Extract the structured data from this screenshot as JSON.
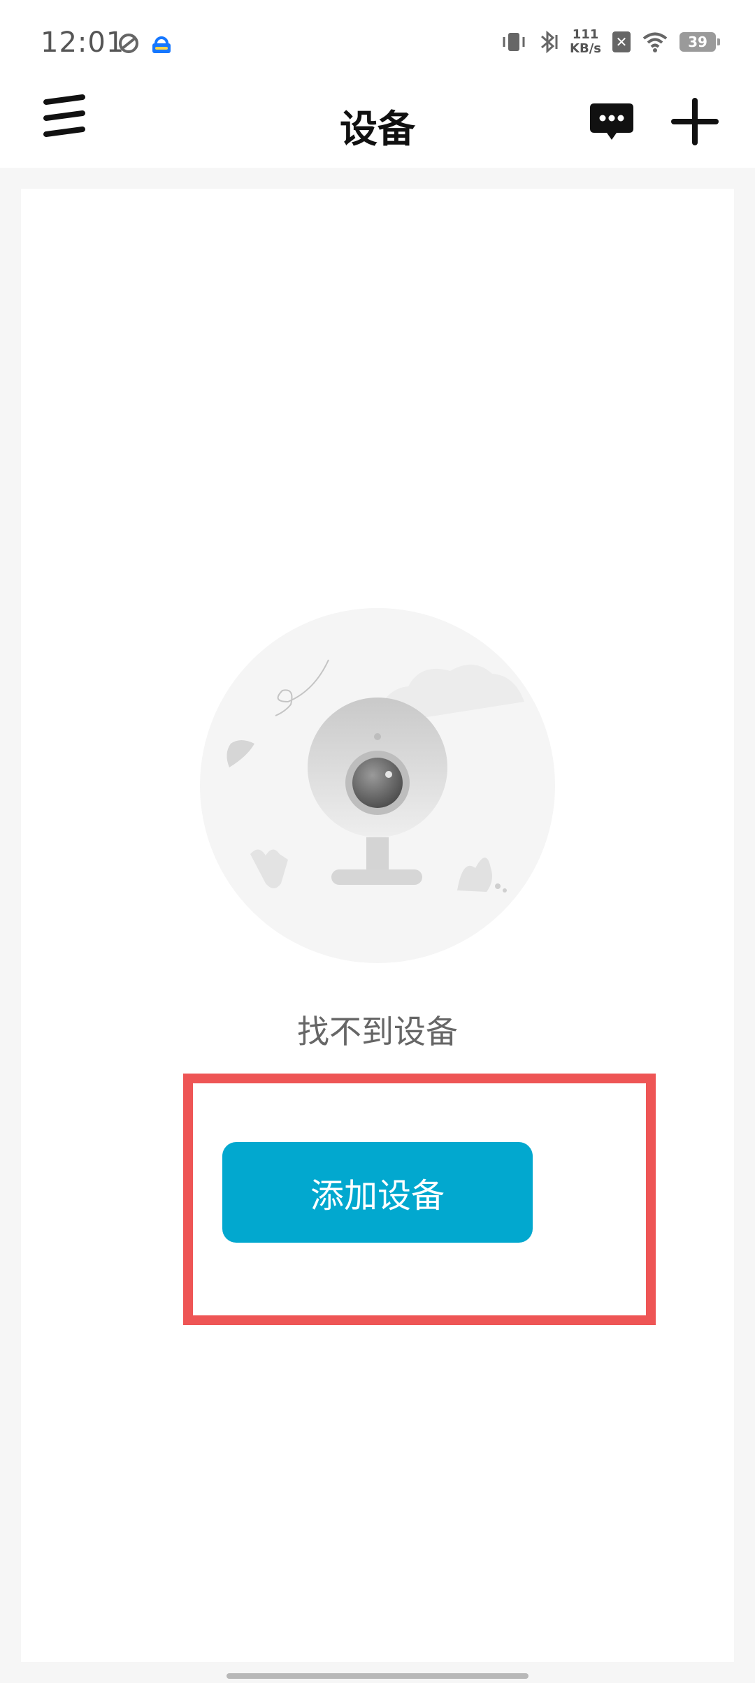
{
  "status_bar": {
    "time": "12:01",
    "net_speed_value": "111",
    "net_speed_unit": "KB/s",
    "battery_level": "39",
    "icons": [
      "sync-icon",
      "app-badge-icon",
      "vibrate-icon",
      "bluetooth-icon",
      "no-sim-icon",
      "wifi-icon",
      "battery-icon"
    ]
  },
  "top_bar": {
    "title": "设备",
    "icons": [
      "menu-icon",
      "message-icon",
      "plus-icon"
    ]
  },
  "empty_state": {
    "message": "找不到设备",
    "illustration": "camera-illustration",
    "button_label": "添加设备"
  },
  "colors": {
    "accent": "#02a8cf",
    "highlight": "#ee5555",
    "background": "#f6f6f6"
  }
}
